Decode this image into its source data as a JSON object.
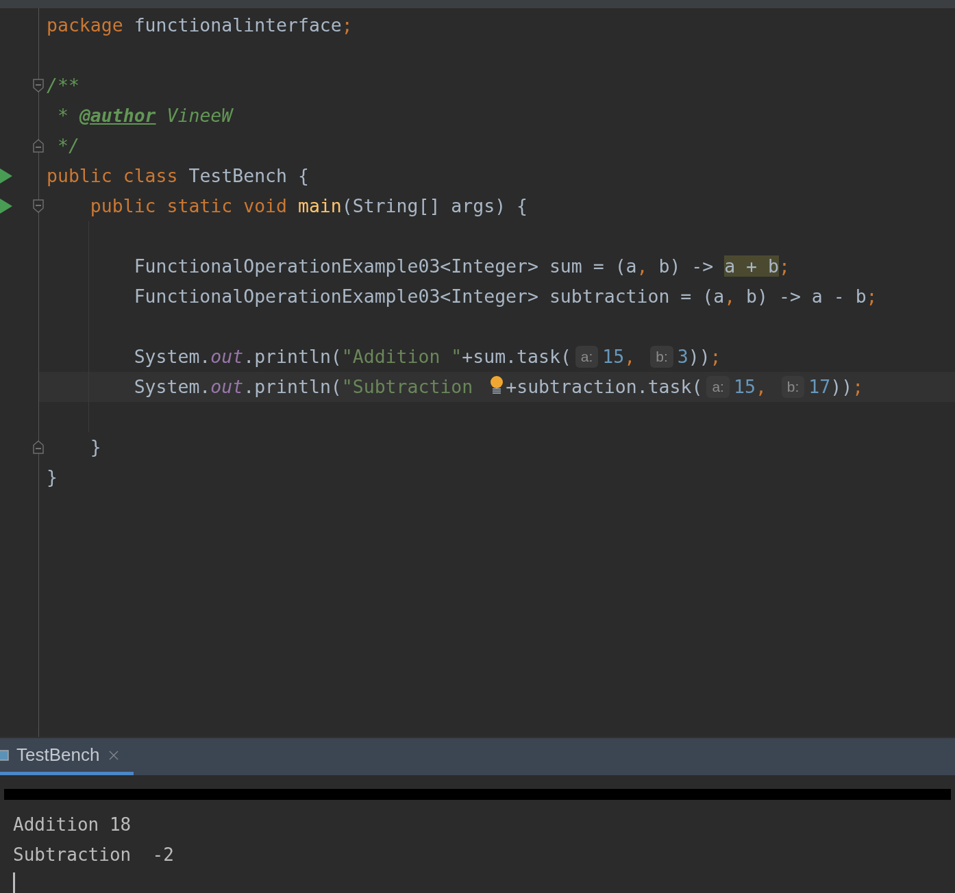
{
  "editor": {
    "lines": [
      {
        "current": false,
        "segments": [
          {
            "kind": "code",
            "tokens": [
              {
                "kind": "kw",
                "t": "package "
              },
              {
                "kind": "plain",
                "t": "functionalinterface"
              },
              {
                "kind": "kw",
                "t": ";"
              }
            ]
          }
        ]
      },
      {
        "current": false
      },
      {
        "current": false,
        "gutter": [
          {
            "kind": "fold_start"
          }
        ],
        "segments": [
          {
            "kind": "code",
            "tokens": [
              {
                "kind": "comment",
                "t": "/**"
              }
            ]
          }
        ]
      },
      {
        "current": false,
        "segments": [
          {
            "kind": "code",
            "tokens": [
              {
                "kind": "comment",
                "t": " * "
              },
              {
                "kind": "doctag",
                "t": "@author"
              },
              {
                "kind": "comment",
                "t": " VineeW"
              }
            ]
          }
        ]
      },
      {
        "current": false,
        "gutter": [
          {
            "kind": "fold_end"
          }
        ],
        "segments": [
          {
            "kind": "code",
            "tokens": [
              {
                "kind": "comment",
                "t": " */"
              }
            ]
          }
        ]
      },
      {
        "current": false,
        "gutter": [
          {
            "kind": "run"
          }
        ],
        "segments": [
          {
            "kind": "code",
            "tokens": [
              {
                "kind": "kw",
                "t": "public class "
              },
              {
                "kind": "plain",
                "t": "TestBench {"
              }
            ]
          }
        ]
      },
      {
        "current": false,
        "gutter": [
          {
            "kind": "run"
          },
          {
            "kind": "fold_start"
          }
        ],
        "segments": [
          {
            "kind": "code",
            "tokens": [
              {
                "kind": "kw",
                "t": "    public static void "
              },
              {
                "kind": "method",
                "t": "main"
              },
              {
                "kind": "plain",
                "t": "(String[] args) {"
              }
            ]
          }
        ]
      },
      {
        "current": false,
        "guide": true
      },
      {
        "current": false,
        "guide": true,
        "segments": [
          {
            "kind": "code",
            "tokens": [
              {
                "kind": "plain",
                "t": "        FunctionalOperationExample03<Integer> sum = (a"
              },
              {
                "kind": "kw",
                "t": ","
              },
              {
                "kind": "plain",
                "t": " b) -> "
              },
              {
                "kind": "match",
                "t": "a + b"
              },
              {
                "kind": "kw",
                "t": ";"
              }
            ]
          }
        ]
      },
      {
        "current": false,
        "guide": true,
        "segments": [
          {
            "kind": "code",
            "tokens": [
              {
                "kind": "plain",
                "t": "        FunctionalOperationExample03<Integer> subtraction = (a"
              },
              {
                "kind": "kw",
                "t": ","
              },
              {
                "kind": "plain",
                "t": " b) -> a - b"
              },
              {
                "kind": "kw",
                "t": ";"
              }
            ]
          }
        ]
      },
      {
        "current": false,
        "guide": true
      },
      {
        "current": false,
        "guide": true,
        "segments": [
          {
            "kind": "code",
            "tokens": [
              {
                "kind": "plain",
                "t": "        System."
              },
              {
                "kind": "field",
                "t": "out"
              },
              {
                "kind": "plain",
                "t": ".println("
              },
              {
                "kind": "string",
                "t": "\"Addition \""
              },
              {
                "kind": "plain",
                "t": "+sum.task("
              }
            ]
          },
          {
            "kind": "hint",
            "text": "a:"
          },
          {
            "kind": "code",
            "tokens": [
              {
                "kind": "num",
                "t": "15"
              },
              {
                "kind": "kw",
                "t": ", "
              }
            ]
          },
          {
            "kind": "hint",
            "text": "b:"
          },
          {
            "kind": "code",
            "tokens": [
              {
                "kind": "num",
                "t": "3"
              },
              {
                "kind": "plain",
                "t": "))"
              },
              {
                "kind": "kw",
                "t": ";"
              }
            ]
          }
        ]
      },
      {
        "current": true,
        "guide": true,
        "segments": [
          {
            "kind": "code",
            "tokens": [
              {
                "kind": "plain",
                "t": "        System."
              },
              {
                "kind": "field",
                "t": "out"
              },
              {
                "kind": "plain",
                "t": ".println("
              },
              {
                "kind": "string",
                "t": "\"Subtraction"
              }
            ]
          },
          {
            "kind": "bulb"
          },
          {
            "kind": "code",
            "tokens": [
              {
                "kind": "plain",
                "t": "+subtraction.task("
              }
            ]
          },
          {
            "kind": "hint",
            "text": "a:"
          },
          {
            "kind": "code",
            "tokens": [
              {
                "kind": "num",
                "t": "15"
              },
              {
                "kind": "kw",
                "t": ", "
              }
            ]
          },
          {
            "kind": "hint",
            "text": "b:"
          },
          {
            "kind": "code",
            "tokens": [
              {
                "kind": "num",
                "t": "17"
              },
              {
                "kind": "plain",
                "t": "))"
              },
              {
                "kind": "kw",
                "t": ";"
              }
            ]
          }
        ]
      },
      {
        "current": false,
        "guide": true
      },
      {
        "current": false,
        "gutter": [
          {
            "kind": "fold_end"
          }
        ],
        "segments": [
          {
            "kind": "code",
            "tokens": [
              {
                "kind": "plain",
                "t": "    }"
              }
            ]
          }
        ]
      },
      {
        "current": false,
        "segments": [
          {
            "kind": "code",
            "tokens": [
              {
                "kind": "plain",
                "t": "}"
              }
            ]
          }
        ]
      }
    ]
  },
  "run_panel": {
    "tabs": [
      {
        "label": "TestBench",
        "selected": true
      }
    ],
    "console": {
      "lines": [
        {
          "kind": "redacted"
        },
        {
          "kind": "output",
          "text": "Addition 18"
        },
        {
          "kind": "output",
          "text": "Subtraction  -2"
        }
      ],
      "cursor": true
    }
  }
}
